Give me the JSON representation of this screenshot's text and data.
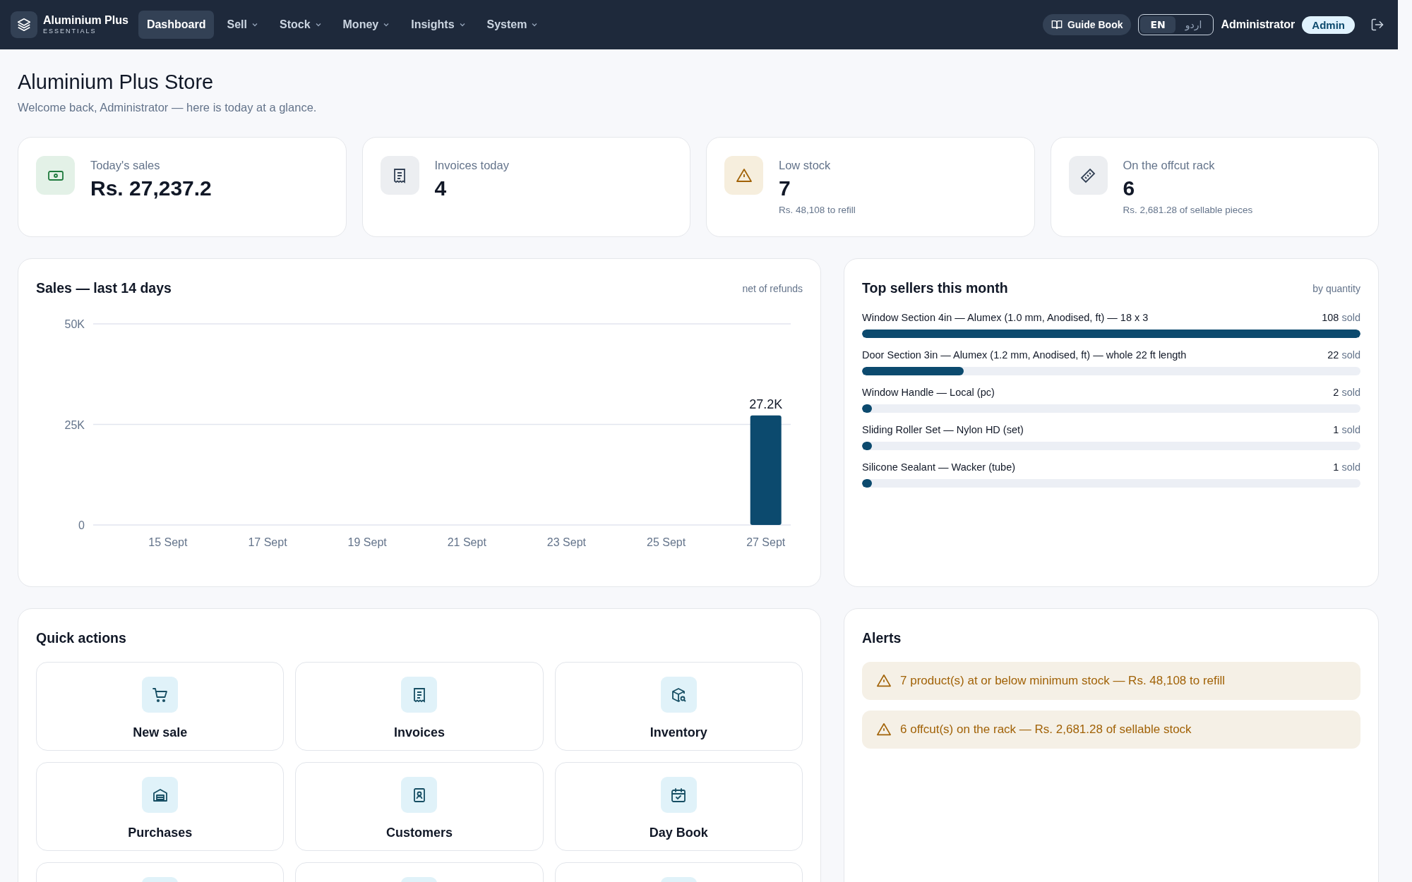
{
  "header": {
    "brand": {
      "name": "Aluminium Plus",
      "tagline": "ESSENTIALS"
    },
    "nav": [
      {
        "label": "Dashboard",
        "selected": true,
        "dropdown": false
      },
      {
        "label": "Sell",
        "selected": false,
        "dropdown": true
      },
      {
        "label": "Stock",
        "selected": false,
        "dropdown": true
      },
      {
        "label": "Money",
        "selected": false,
        "dropdown": true
      },
      {
        "label": "Insights",
        "selected": false,
        "dropdown": true
      },
      {
        "label": "System",
        "selected": false,
        "dropdown": true
      }
    ],
    "guide_button": "Guide Book",
    "languages": [
      {
        "label": "EN",
        "selected": true
      },
      {
        "label": "اردو",
        "selected": false
      }
    ],
    "user": "Administrator",
    "role": "Admin"
  },
  "page": {
    "title": "Aluminium Plus Store",
    "subtitle": "Welcome back, Administrator — here is today at a glance."
  },
  "stats": [
    {
      "kind": "money",
      "label": "Today's sales",
      "value": "Rs. 27,237.2"
    },
    {
      "kind": "invoice",
      "label": "Invoices today",
      "value": "4"
    },
    {
      "kind": "warning",
      "label": "Low stock",
      "value": "7",
      "note": "Rs. 48,108 to refill"
    },
    {
      "kind": "ruler",
      "label": "On the offcut rack",
      "value": "6",
      "note": "Rs. 2,681.28 of sellable pieces"
    }
  ],
  "sales_chart": {
    "title": "Sales — last 14 days",
    "note": "net of refunds",
    "chart_data": {
      "type": "bar",
      "categories": [
        "15 Sept",
        "17 Sept",
        "19 Sept",
        "21 Sept",
        "23 Sept",
        "25 Sept",
        "27 Sept"
      ],
      "values": [
        0,
        0,
        0,
        0,
        0,
        0,
        27237.2
      ],
      "value_labels": [
        null,
        null,
        null,
        null,
        null,
        null,
        "27.2K"
      ],
      "ylim": [
        0,
        50000
      ],
      "yticks": [
        {
          "value": 0,
          "label": "0"
        },
        {
          "value": 25000,
          "label": "25K"
        },
        {
          "value": 50000,
          "label": "50K"
        }
      ],
      "color": "#0c4a6e"
    }
  },
  "top_sellers": {
    "title": "Top sellers this month",
    "note": "by quantity",
    "items": [
      {
        "name": "Window Section 4in — Alumex (1.0 mm, Anodised, ft) — 18 x 3",
        "count": "108",
        "unit": "sold",
        "level": 1
      },
      {
        "name": "Door Section 3in — Alumex (1.2 mm, Anodised, ft) — whole 22 ft length",
        "count": "22",
        "unit": "sold",
        "level": 0.204
      },
      {
        "name": "Window Handle — Local (pc)",
        "count": "2",
        "unit": "sold",
        "level": 0.019
      },
      {
        "name": "Sliding Roller Set — Nylon HD (set)",
        "count": "1",
        "unit": "sold",
        "level": 0.009
      },
      {
        "name": "Silicone Sealant — Wacker (tube)",
        "count": "1",
        "unit": "sold",
        "level": 0.009
      }
    ]
  },
  "quick_actions": {
    "title": "Quick actions",
    "items": [
      {
        "kind": "cart",
        "label": "New sale"
      },
      {
        "kind": "receipt",
        "label": "Invoices"
      },
      {
        "kind": "box",
        "label": "Inventory"
      },
      {
        "kind": "warehouse",
        "label": "Purchases"
      },
      {
        "kind": "contacts",
        "label": "Customers"
      },
      {
        "kind": "calendar",
        "label": "Day Book"
      },
      {
        "kind": "hidden"
      },
      {
        "kind": "hidden"
      },
      {
        "kind": "hidden"
      }
    ]
  },
  "alerts": {
    "title": "Alerts",
    "items": [
      {
        "text": "7 product(s) at or below minimum stock — Rs. 48,108 to refill"
      },
      {
        "text": "6 offcut(s) on the rack — Rs. 2,681.28 of sellable stock"
      }
    ]
  }
}
